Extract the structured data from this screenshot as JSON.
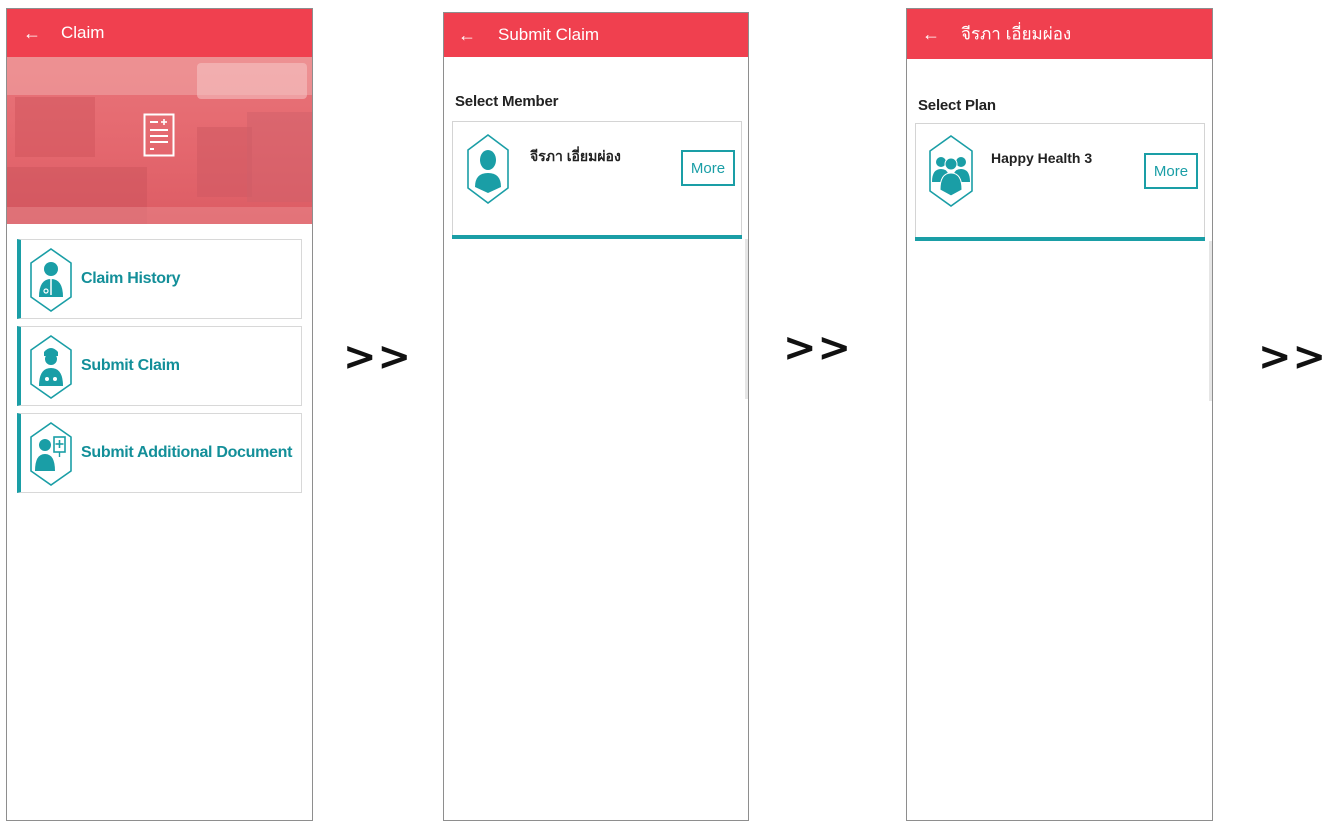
{
  "screen1": {
    "back_glyph": "←",
    "title": "Claim",
    "menu": [
      {
        "label": "Claim History",
        "icon": "doctor-icon"
      },
      {
        "label": "Submit Claim",
        "icon": "nurse-icon"
      },
      {
        "label": "Submit Additional Document",
        "icon": "patient-document-icon"
      }
    ]
  },
  "screen2": {
    "back_glyph": "←",
    "title": "Submit Claim",
    "section_label": "Select Member",
    "member_name": "จีรภา เอี่ยมผ่อง",
    "more_label": "More"
  },
  "screen3": {
    "back_glyph": "←",
    "title": "จีรภา เอี่ยมผ่อง",
    "section_label": "Select Plan",
    "plan_name": "Happy Health 3",
    "more_label": "More"
  },
  "arrows": [
    ">>",
    ">>",
    ">>"
  ],
  "colors": {
    "appbar": "#f0404f",
    "accent": "#1a9ea6",
    "hero": "#e4676e"
  }
}
